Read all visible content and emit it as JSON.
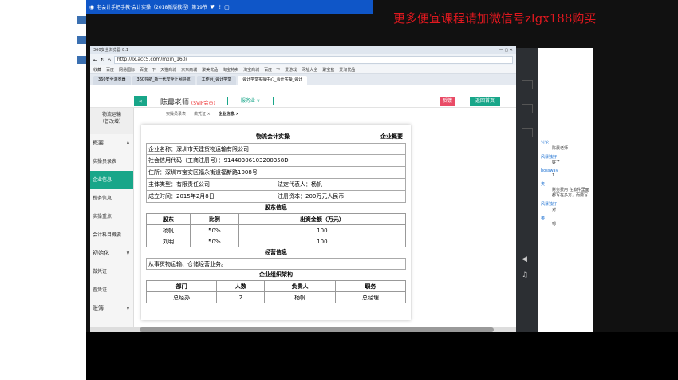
{
  "player": {
    "title": "老会计手把手教·会计实操（2018新版教程）第19节",
    "watermark": "更多便宜课程请加微信号zlgx188购买"
  },
  "browser": {
    "name": "360安全浏览器 8.1",
    "url": "http://lx.acc5.com/mxin_160/",
    "favorites": [
      "收藏",
      "百度",
      "网易国际",
      "百度一下",
      "天猫商城",
      "京东商城",
      "聚美优品",
      "淘宝特卖",
      "淘宝商城",
      "百度一下",
      "爱游戏",
      "网址大全",
      "聚宝盆",
      "爱淘优品"
    ],
    "tabs": [
      "360安全浏览器",
      "360导航_新一代安全上网导航",
      "工作台_会计学堂",
      "会计学堂实操中心_会计实操_会计"
    ]
  },
  "app": {
    "collapse_icon": "«",
    "user_name": "陈晨老师",
    "user_level": "(SVIP会员)",
    "service_label": "服务业 ∨",
    "feedback_label": "反馈",
    "back_home_label": "返回首页",
    "brand_line1": "物流运输",
    "brand_line2": "（普改增）",
    "sidebar": [
      {
        "label": "概要",
        "group": true,
        "arrow": "∧"
      },
      {
        "label": "实操员录表",
        "group": false
      },
      {
        "label": "企业信息",
        "group": false,
        "active": true
      },
      {
        "label": "税务信息",
        "group": false
      },
      {
        "label": "实操重点",
        "group": false
      },
      {
        "label": "会计科目概要",
        "group": false
      },
      {
        "label": "初始化",
        "group": true,
        "arrow": "∨"
      },
      {
        "label": "做凭证",
        "group": false
      },
      {
        "label": "查凭证",
        "group": false
      },
      {
        "label": "账簿",
        "group": true,
        "arrow": "∨"
      }
    ],
    "subtabs": [
      "实操员录表",
      "做凭证 ×",
      "企业信息 ×"
    ]
  },
  "doc": {
    "title": "物流会计实操",
    "right_title": "企业概要",
    "company_name": "企业名称：深圳市天建货物运输有限公司",
    "credit_code": "社会信用代码（工商注册号）：91440306103200358D",
    "address": "住所：深圳市宝安区福永街道福新路1008号",
    "type": "主体类型：有限责任公司",
    "legal_rep": "法定代表人：杨帆",
    "founded": "成立时间：2015年2月8日",
    "capital": "注册资本：200万元人民币",
    "shareholders_title": "股东信息",
    "shareholder_headers": [
      "股东",
      "比例",
      "出资金额（万元）"
    ],
    "shareholders": [
      [
        "杨帆",
        "50%",
        "100"
      ],
      [
        "刘明",
        "50%",
        "100"
      ]
    ],
    "business_title": "经营信息",
    "business": "从事货物运输、仓储经营业务。",
    "org_title": "企业组织架构",
    "org_headers": [
      "部门",
      "人数",
      "负责人",
      "职务"
    ],
    "org_rows": [
      [
        "总经办",
        "2",
        "杨帆",
        "总经理"
      ]
    ]
  },
  "chat": {
    "tab": "讨论",
    "messages": [
      {
        "user": "",
        "text": "陈晨老师"
      },
      {
        "user": "风暴独好",
        "text": "好了"
      },
      {
        "user": "bossway",
        "text": "1"
      },
      {
        "user": "奥",
        "text": "财务费用 在软件里面 都写在多方，而要写"
      },
      {
        "user": "风暴独好",
        "text": "对"
      },
      {
        "user": "奥",
        "text": "嗯"
      }
    ]
  }
}
